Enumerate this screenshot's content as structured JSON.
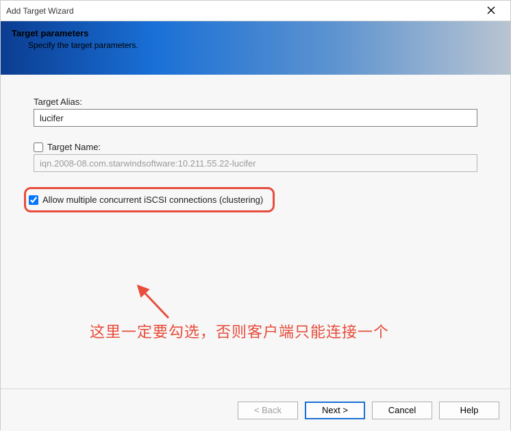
{
  "window": {
    "title": "Add Target Wizard"
  },
  "banner": {
    "heading": "Target parameters",
    "subheading": "Specify the target parameters."
  },
  "form": {
    "targetAliasLabel": "Target Alias:",
    "targetAliasValue": "lucifer",
    "targetNameLabel": "Target Name:",
    "targetNameChecked": false,
    "targetNameValue": "iqn.2008-08.com.starwindsoftware:10.211.55.22-lucifer",
    "allowMultipleChecked": true,
    "allowMultipleLabel": "Allow multiple concurrent iSCSI connections (clustering)"
  },
  "annotation": {
    "text": "这里一定要勾选，否则客户端只能连接一个"
  },
  "buttons": {
    "back": "< Back",
    "next": "Next >",
    "cancel": "Cancel",
    "help": "Help"
  }
}
